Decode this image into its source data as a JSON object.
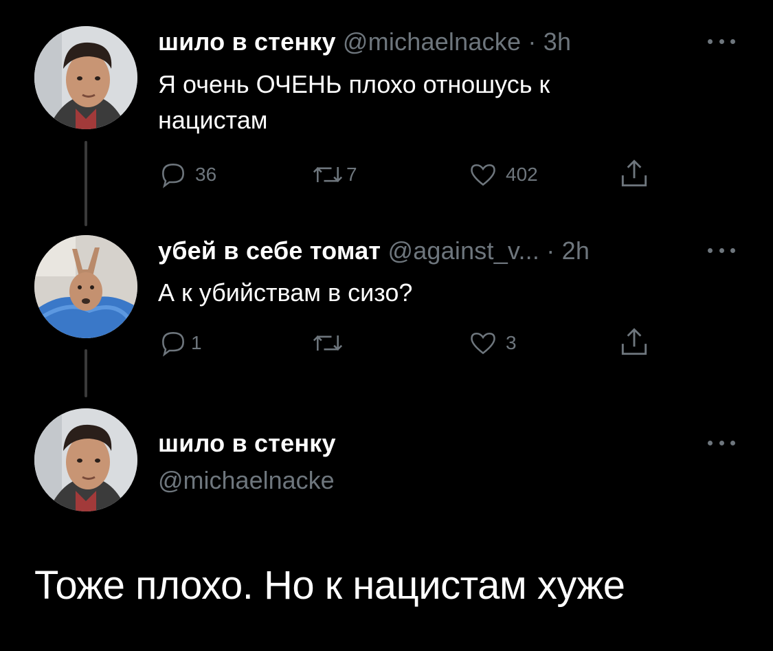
{
  "tweets": [
    {
      "name": "шило в стенку",
      "handle": "@michaelnacke",
      "sep": "·",
      "time": "3h",
      "text_line1": "Я очень ОЧЕНЬ плохо отношусь к",
      "text_line2": "нацистам",
      "replies": "36",
      "retweets": "7",
      "likes": "402"
    },
    {
      "name": "убей в себе томат",
      "handle": "@against_v...",
      "sep": "·",
      "time": "2h",
      "text": "А к убийствам в сизо?",
      "replies": "1",
      "retweets": "",
      "likes": "3"
    }
  ],
  "main_tweet": {
    "name": "шило в стенку",
    "handle": "@michaelnacke",
    "text": "Тоже плохо. Но к нацистам хуже"
  },
  "icons": [
    "reply-icon",
    "retweet-icon",
    "like-icon",
    "share-icon",
    "more-icon"
  ],
  "colors": {
    "background": "#000000",
    "text": "#ffffff",
    "secondary": "#6e767d",
    "thread_line": "#3a3a3a"
  }
}
